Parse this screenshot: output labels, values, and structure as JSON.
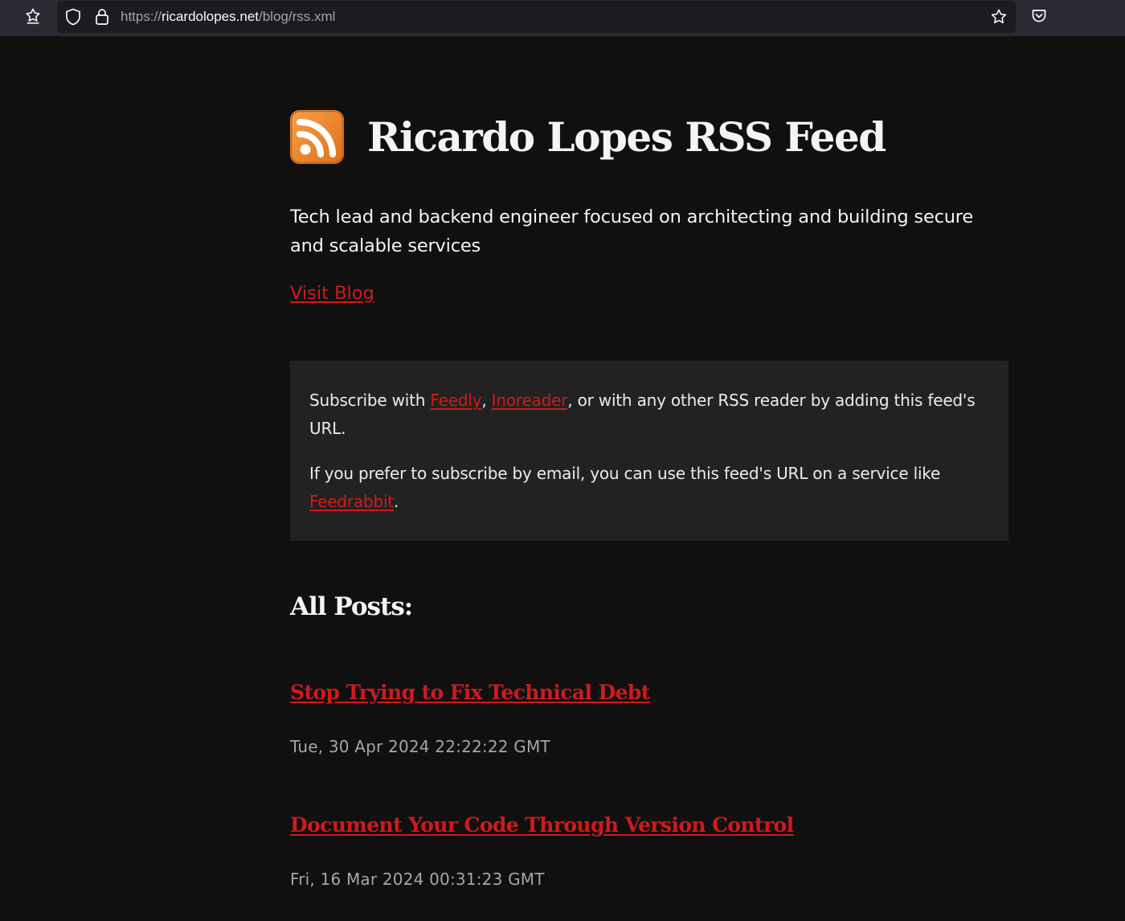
{
  "browser": {
    "url_scheme": "https://",
    "url_host": "ricardolopes.net",
    "url_path": "/blog/rss.xml",
    "icons": [
      "puzzle-star-icon",
      "shield-icon",
      "lock-icon",
      "bookmark-star-icon",
      "pocket-icon"
    ]
  },
  "page": {
    "title": "Ricardo Lopes RSS Feed",
    "description": "Tech lead and backend engineer focused on architecting and building secure and scalable services",
    "visit_blog_label": "Visit Blog",
    "subscribe": {
      "line1_prefix": "Subscribe with ",
      "feedly_label": "Feedly",
      "separator": ", ",
      "inoreader_label": "Inoreader",
      "line1_suffix": ", or with any other RSS reader by adding this feed's URL.",
      "line2_prefix": "If you prefer to subscribe by email, you can use this feed's URL on a service like ",
      "feedrabbit_label": "Feedrabbit",
      "line2_suffix": "."
    },
    "posts_heading": "All Posts:",
    "posts": [
      {
        "title": "Stop Trying to Fix Technical Debt",
        "date": "Tue, 30 Apr 2024 22:22:22 GMT"
      },
      {
        "title": "Document Your Code Through Version Control",
        "date": "Fri, 16 Mar 2024 00:31:23 GMT"
      }
    ]
  },
  "colors": {
    "background": "#101011",
    "link": "#d01a1a",
    "box": "#222223",
    "rss_orange": "#f08a24"
  }
}
